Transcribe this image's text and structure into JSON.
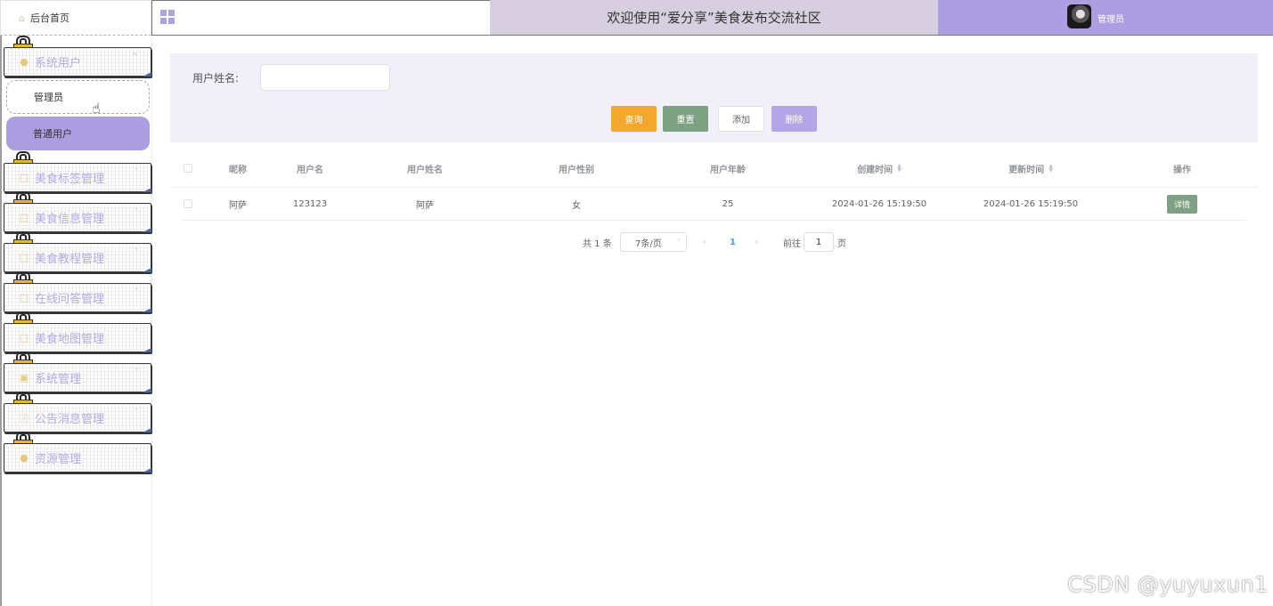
{
  "header": {
    "home_label": "后台首页",
    "title": "欢迎使用“爱分享”美食发布交流社区",
    "user_name": "管理员"
  },
  "sidebar": {
    "items": [
      {
        "label": "系统用户",
        "icon": "user-icon",
        "expanded": true
      },
      {
        "label": "美食标签管理",
        "icon": "doc-icon"
      },
      {
        "label": "美食信息管理",
        "icon": "doc-icon"
      },
      {
        "label": "美食教程管理",
        "icon": "doc-icon"
      },
      {
        "label": "在线问答管理",
        "icon": "doc-icon"
      },
      {
        "label": "美食地图管理",
        "icon": "doc-icon"
      },
      {
        "label": "系统管理",
        "icon": "chart-icon"
      },
      {
        "label": "公告消息管理",
        "icon": "info-icon"
      },
      {
        "label": "资源管理",
        "icon": "bulb-icon"
      }
    ],
    "sub_items": [
      {
        "label": "管理员"
      },
      {
        "label": "普通用户",
        "active": true
      }
    ]
  },
  "search": {
    "label": "用户姓名:",
    "value": "",
    "placeholder": "",
    "buttons": {
      "query": "查询",
      "reset": "重置",
      "add": "添加",
      "delete": "删除"
    }
  },
  "table": {
    "headers": [
      "昵称",
      "用户名",
      "用户姓名",
      "用户性别",
      "用户年龄",
      "创建时间",
      "更新时间",
      "操作"
    ],
    "rows": [
      {
        "nickname": "阿萨",
        "username": "123123",
        "realname": "阿萨",
        "gender": "女",
        "age": "25",
        "created": "2024-01-26 15:19:50",
        "updated": "2024-01-26 15:19:50",
        "action": "详情"
      }
    ]
  },
  "pagination": {
    "total": "共 1 条",
    "page_size": "7条/页",
    "current_page": "1",
    "goto_label": "前往",
    "goto_value": "1",
    "page_unit": "页"
  },
  "watermark": "CSDN @yuyuxun1",
  "colors": {
    "accent_purple": "#ac9ee0",
    "title_bg": "#d7cfdf",
    "query": "#f3a72c",
    "reset": "#7ea083",
    "delete": "#b4a5e8"
  }
}
